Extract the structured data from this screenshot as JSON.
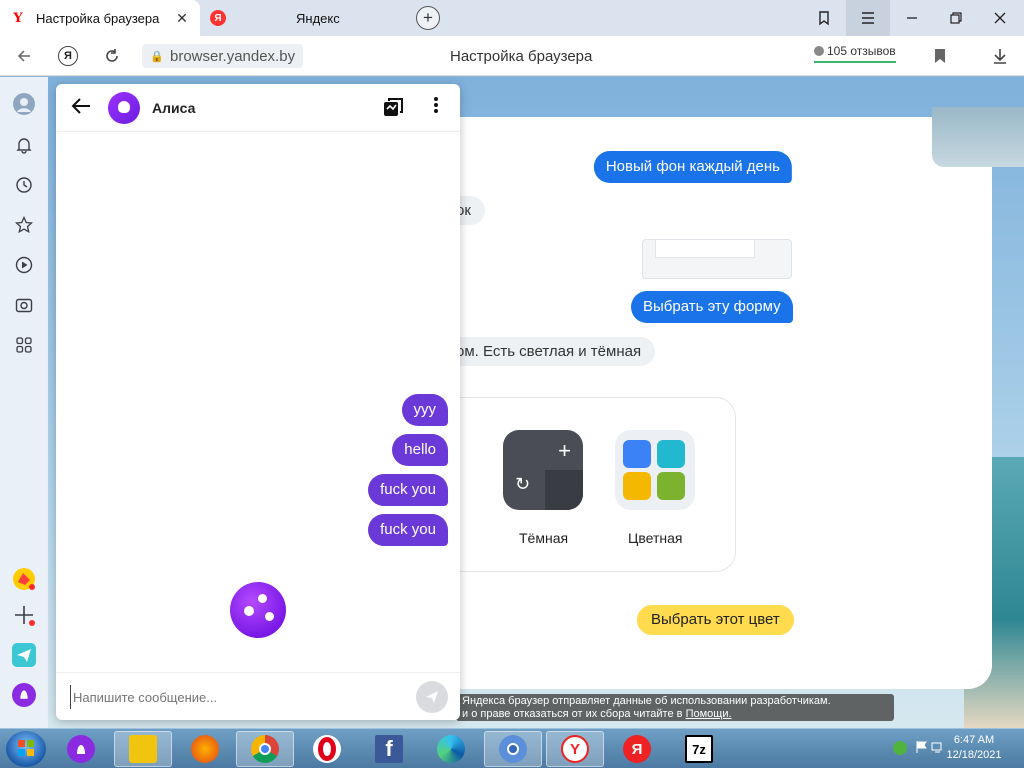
{
  "browser": {
    "tabs": [
      {
        "title": "Настройка браузера",
        "icon": "yandex-y-icon",
        "active": true
      },
      {
        "title": "Яндекс",
        "icon": "yandex-circle-icon",
        "active": false
      }
    ],
    "address": {
      "url": "browser.yandex.by",
      "page_title": "Настройка браузера",
      "reviews": "105 отзывов"
    }
  },
  "background_page": {
    "messages": {
      "new_bg_daily": "Новый фон каждый день",
      "ok_fragment": "ок",
      "choose_form": "Выбрать эту форму",
      "theme_note": "ом. Есть светлая и тёмная",
      "choose_color": "Выбрать этот цвет"
    },
    "themes": [
      {
        "label": "Тёмная"
      },
      {
        "label": "Цветная"
      }
    ],
    "notice": {
      "line1": "Яндекса браузер отправляет данные об использовании разработчикам.",
      "line2": "и о праве отказаться от их сбора читайте в",
      "link": "Помощи."
    }
  },
  "alice": {
    "name": "Алиса",
    "messages": [
      "yyy",
      "hello",
      "fuck you",
      "fuck you"
    ],
    "input_placeholder": "Напишите сообщение..."
  },
  "taskbar": {
    "clock_time": "6:47 AM",
    "clock_date": "12/18/2021"
  },
  "colors": {
    "accent_blue": "#1a73e8",
    "alice_purple": "#6c39d9",
    "yellow_button": "#ffdb4d"
  }
}
